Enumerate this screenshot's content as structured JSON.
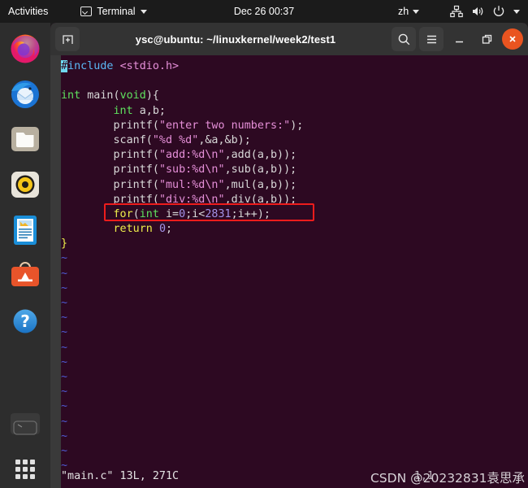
{
  "topbar": {
    "activities": "Activities",
    "app_name": "Terminal",
    "app_icon": "terminal-icon",
    "clock": "Dec 26  00:37",
    "language": "zh",
    "icons": [
      "network-icon",
      "volume-icon",
      "power-icon",
      "chevron-down-icon"
    ]
  },
  "dock": {
    "items": [
      {
        "name": "firefox",
        "label": "Firefox"
      },
      {
        "name": "thunderbird",
        "label": "Thunderbird Mail"
      },
      {
        "name": "files",
        "label": "Files"
      },
      {
        "name": "rhythmbox",
        "label": "Rhythmbox"
      },
      {
        "name": "libreoffice-writer",
        "label": "LibreOffice Writer"
      },
      {
        "name": "ubuntu-software",
        "label": "Ubuntu Software"
      },
      {
        "name": "help",
        "label": "Help"
      },
      {
        "name": "trash",
        "label": "Trash"
      },
      {
        "name": "show-applications",
        "label": "Show Applications"
      }
    ]
  },
  "window": {
    "title": "ysc@ubuntu: ~/linuxkernel/week2/test1",
    "new_tab_label": "+",
    "search_label": "Search",
    "menu_label": "Menu",
    "minimize_label": "Minimize",
    "maximize_label": "Restore",
    "close_label": "Close",
    "accent_close": "#e95420",
    "background": "#2d0922"
  },
  "editor": {
    "lines": [
      {
        "indent": 0,
        "tokens": [
          {
            "t": "#",
            "c": "cursor"
          },
          {
            "t": "include",
            "c": "inc"
          },
          {
            "t": " ",
            "c": "pln"
          },
          {
            "t": "<stdio.h>",
            "c": "str"
          }
        ]
      },
      {
        "indent": 0,
        "tokens": []
      },
      {
        "indent": 0,
        "tokens": [
          {
            "t": "int",
            "c": "typ"
          },
          {
            "t": " main(",
            "c": "pln"
          },
          {
            "t": "void",
            "c": "typ"
          },
          {
            "t": "){",
            "c": "pln"
          }
        ]
      },
      {
        "indent": 8,
        "tokens": [
          {
            "t": "int",
            "c": "typ"
          },
          {
            "t": " a,b;",
            "c": "pln"
          }
        ]
      },
      {
        "indent": 8,
        "tokens": [
          {
            "t": "printf(",
            "c": "pln"
          },
          {
            "t": "\"enter two numbers:\"",
            "c": "str"
          },
          {
            "t": ");",
            "c": "pln"
          }
        ]
      },
      {
        "indent": 8,
        "tokens": [
          {
            "t": "scanf(",
            "c": "pln"
          },
          {
            "t": "\"%d %d\"",
            "c": "str"
          },
          {
            "t": ",&a,&b);",
            "c": "pln"
          }
        ]
      },
      {
        "indent": 8,
        "tokens": [
          {
            "t": "printf(",
            "c": "pln"
          },
          {
            "t": "\"add:%d\\n\"",
            "c": "str"
          },
          {
            "t": ",add(a,b));",
            "c": "pln"
          }
        ]
      },
      {
        "indent": 8,
        "tokens": [
          {
            "t": "printf(",
            "c": "pln"
          },
          {
            "t": "\"sub:%d\\n\"",
            "c": "str"
          },
          {
            "t": ",sub(a,b));",
            "c": "pln"
          }
        ]
      },
      {
        "indent": 8,
        "tokens": [
          {
            "t": "printf(",
            "c": "pln"
          },
          {
            "t": "\"mul:%d\\n\"",
            "c": "str"
          },
          {
            "t": ",mul(a,b));",
            "c": "pln"
          }
        ]
      },
      {
        "indent": 8,
        "tokens": [
          {
            "t": "printf(",
            "c": "pln"
          },
          {
            "t": "\"div:%d\\n\"",
            "c": "str"
          },
          {
            "t": ",div(a,b));",
            "c": "pln"
          }
        ]
      },
      {
        "indent": 8,
        "tokens": [
          {
            "t": "for",
            "c": "kw"
          },
          {
            "t": "(",
            "c": "pln"
          },
          {
            "t": "int",
            "c": "typ"
          },
          {
            "t": " i=",
            "c": "pln"
          },
          {
            "t": "0",
            "c": "num"
          },
          {
            "t": ";i<",
            "c": "pln"
          },
          {
            "t": "2831",
            "c": "num"
          },
          {
            "t": ";i++);",
            "c": "pln"
          }
        ]
      },
      {
        "indent": 8,
        "tokens": [
          {
            "t": "return",
            "c": "kw"
          },
          {
            "t": " ",
            "c": "pln"
          },
          {
            "t": "0",
            "c": "num"
          },
          {
            "t": ";",
            "c": "pln"
          }
        ]
      },
      {
        "indent": 0,
        "tokens": [
          {
            "t": "}",
            "c": "kw"
          }
        ]
      }
    ],
    "empty_line_marker": "~",
    "empty_line_count": 15,
    "status_line": "\"main.c\" 13L, 271C",
    "cursor_position": "1,1",
    "annotation": {
      "name": "red-highlight-box",
      "color": "#ee1c1c",
      "targets_line": "for(int i=0;i<2831;i++);"
    }
  },
  "watermark": {
    "text": "CSDN @20232831袁思承"
  },
  "colors": {
    "keyword": "#eded4a",
    "type": "#5ee05e",
    "string": "#e58fd8",
    "number": "#a393e8",
    "preproc": "#5bb8f5",
    "tilde": "#4f5bd5",
    "cursor": "#6fd8f0"
  }
}
